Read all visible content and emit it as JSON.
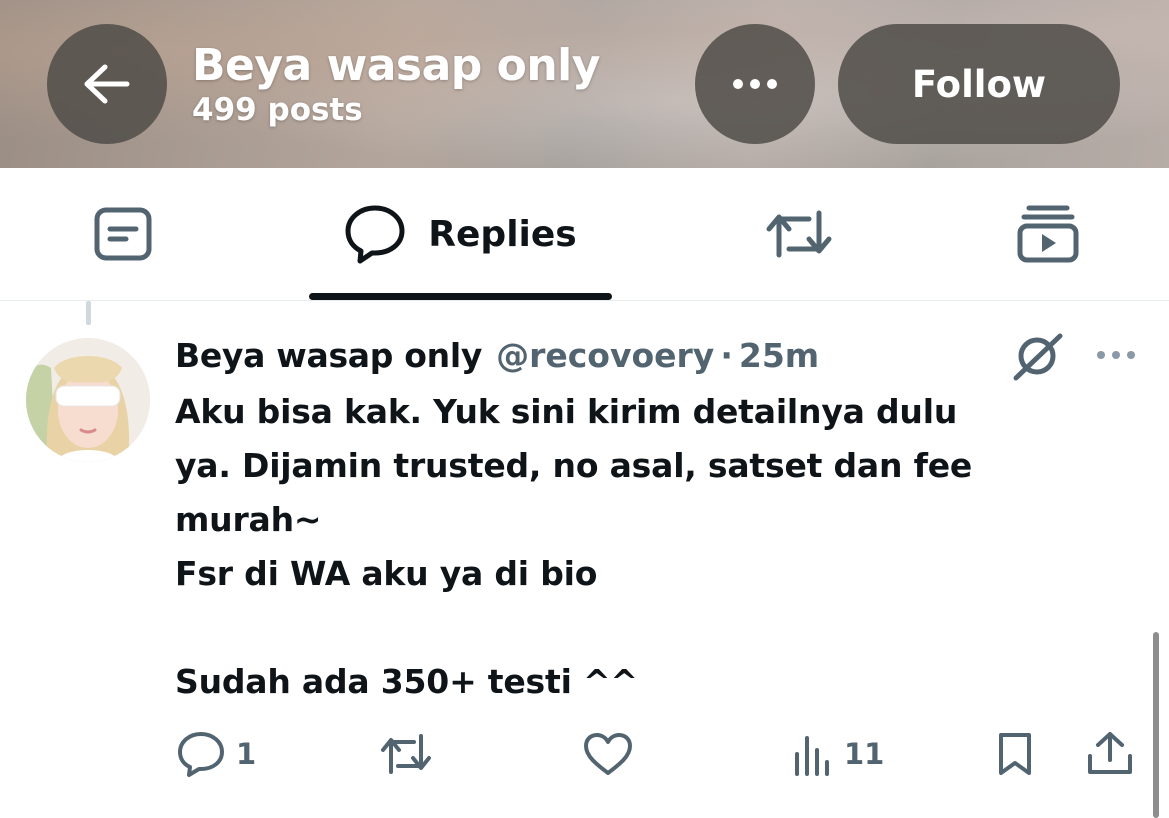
{
  "header": {
    "title": "Beya wasap only",
    "post_count": "499 posts",
    "follow_label": "Follow",
    "back_icon": "back-arrow-icon",
    "more_icon": "more-horizontal-icon"
  },
  "tabs": [
    {
      "id": "posts",
      "icon": "posts-icon",
      "label": ""
    },
    {
      "id": "replies",
      "icon": "reply-bubble-icon",
      "label": "Replies",
      "active": true
    },
    {
      "id": "reposts",
      "icon": "repost-icon",
      "label": ""
    },
    {
      "id": "media",
      "icon": "media-icon",
      "label": ""
    }
  ],
  "post": {
    "author_name": "Beya wasap only",
    "handle": "@recovoery",
    "separator": "·",
    "time": "25m",
    "text_lines": [
      "Aku bisa kak. Yuk sini kirim detailnya dulu",
      "ya. Dijamin trusted, no asal, satset dan fee",
      "murah~",
      "Fsr di WA aku ya di bio",
      "",
      "Sudah ada 350+ testi ^^"
    ],
    "actions": {
      "reply_count": "1",
      "repost_count": "",
      "like_count": "",
      "views_count": "11"
    }
  },
  "colors": {
    "text_primary": "#0f1419",
    "text_secondary": "#536471",
    "header_button_bg": "#504c48",
    "tab_underline": "#0f1419",
    "divider": "#e6ecf0"
  }
}
